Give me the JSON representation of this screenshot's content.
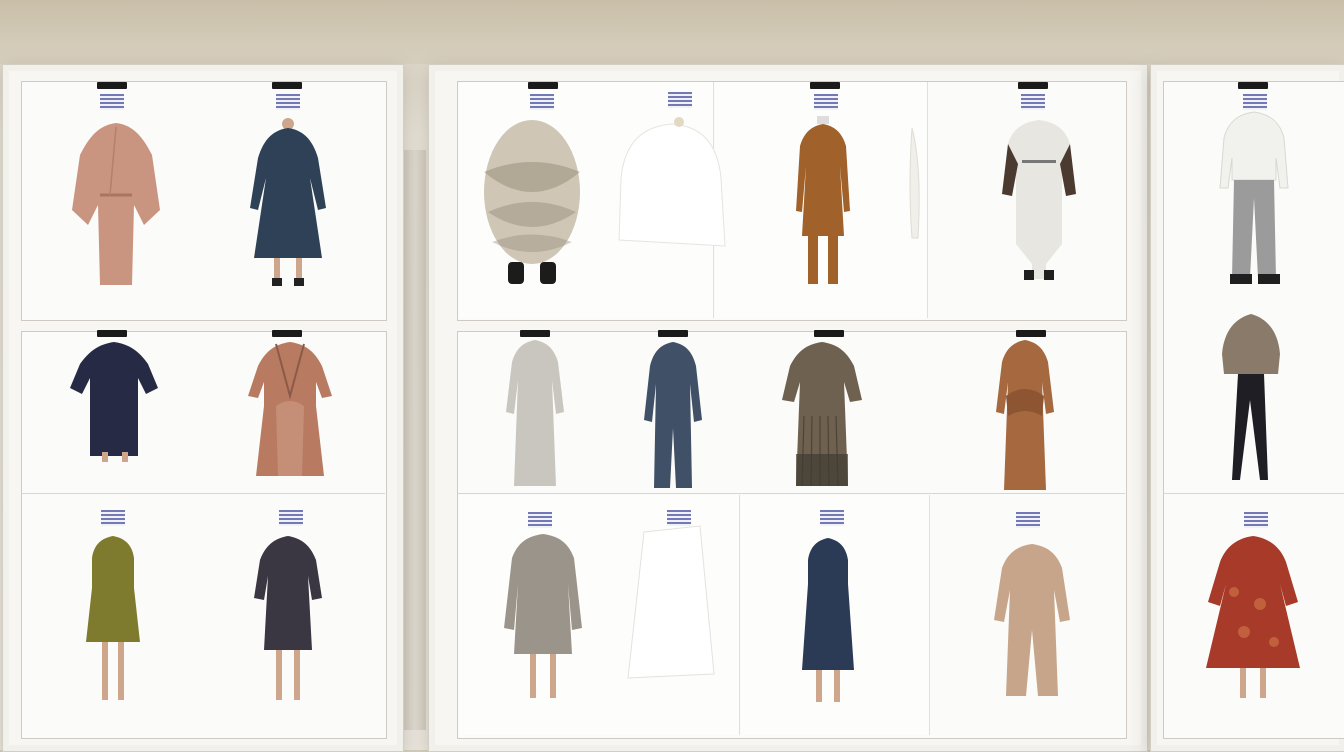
{
  "scene": {
    "colors": {
      "wall": "#d6cfbf",
      "board": "#f7f6f2",
      "clip": "#1a1a1a",
      "tag_ink": "#5b62a8"
    }
  },
  "garments": [
    {
      "id": "g1",
      "color": "#c99580",
      "style": "cape"
    },
    {
      "id": "g2",
      "color": "#2f4156",
      "style": "coat-dress"
    },
    {
      "id": "g3",
      "color": "#262a44",
      "style": "short-dress"
    },
    {
      "id": "g4",
      "color": "#b97a62",
      "style": "wrap-dress"
    },
    {
      "id": "g5",
      "color": "#7f7b2e",
      "style": "sleeveless-dress"
    },
    {
      "id": "g6",
      "color": "#3a3642",
      "style": "shirt-dress"
    },
    {
      "id": "g7",
      "color": "#cfc6b5",
      "style": "fur-coat"
    },
    {
      "id": "g8",
      "color": "#ffffff",
      "style": "white-cape"
    },
    {
      "id": "g9",
      "color": "#a0622a",
      "style": "tunic-trousers"
    },
    {
      "id": "g10",
      "color": "#e8e6e0",
      "style": "jacket-pants"
    },
    {
      "id": "g11",
      "color": "#c9c6bf",
      "style": "gown"
    },
    {
      "id": "g12",
      "color": "#3f5067",
      "style": "suit"
    },
    {
      "id": "g13",
      "color": "#6e6150",
      "style": "pleated-dress"
    },
    {
      "id": "g14",
      "color": "#a5683f",
      "style": "draped-dress"
    },
    {
      "id": "g15",
      "color": "#9b948a",
      "style": "long-coat"
    },
    {
      "id": "g16",
      "color": "#ffffff",
      "style": "white-sheet"
    },
    {
      "id": "g17",
      "color": "#2c3b55",
      "style": "sleeveless-dress"
    },
    {
      "id": "g18",
      "color": "#c6a58a",
      "style": "jumpsuit"
    },
    {
      "id": "g19",
      "color": "#f1f1ee",
      "style": "blouse-trousers"
    },
    {
      "id": "g20",
      "color": "#8a7a69",
      "style": "knit-top"
    },
    {
      "id": "g21",
      "color": "#a83a2a",
      "style": "printed-dress"
    }
  ]
}
